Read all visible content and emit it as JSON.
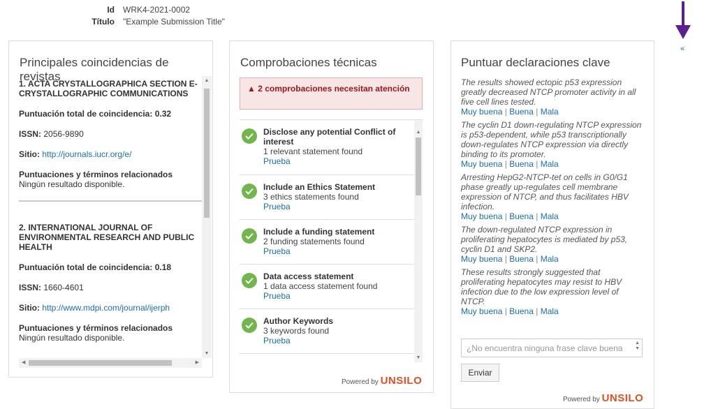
{
  "meta": {
    "id_label": "Id",
    "id_value": "WRK4-2021-0002",
    "title_label": "Título",
    "title_value": "\"Example Submission Title\""
  },
  "collapse_label": "«",
  "journals": {
    "heading": "Principales coincidencias de revistas",
    "items": [
      {
        "name": "1. ACTA CRYSTALLOGRAPHICA SECTION E-CRYSTALLOGRAPHIC COMMUNICATIONS",
        "score_label": "Puntuación total de coincidencia: 0.32",
        "issn_label": "ISSN:",
        "issn_value": "2056-9890",
        "site_label": "Sitio:",
        "site_url": "http://journals.iucr.org/e/",
        "terms_label": "Puntuaciones y términos relacionados",
        "terms_value": "Ningún resultado disponible."
      },
      {
        "name": "2. INTERNATIONAL JOURNAL OF ENVIRONMENTAL RESEARCH AND PUBLIC HEALTH",
        "score_label": "Puntuación total de coincidencia: 0.18",
        "issn_label": "ISSN:",
        "issn_value": "1660-4601",
        "site_label": "Sitio:",
        "site_url": "http://www.mdpi.com/journal/ijerph",
        "terms_label": "Puntuaciones y términos relacionados",
        "terms_value": "Ningún resultado disponible."
      }
    ]
  },
  "checks": {
    "heading": "Comprobaciones técnicas",
    "alert": "2 comprobaciones necesitan atención",
    "items": [
      {
        "title": "Disclose any potential Conflict of interest",
        "desc": "1 relevant statement found",
        "link": "Prueba"
      },
      {
        "title": "Include an Ethics Statement",
        "desc": "3 ethics statements found",
        "link": "Prueba"
      },
      {
        "title": "Include a funding statement",
        "desc": "2 funding statements found",
        "link": "Prueba"
      },
      {
        "title": "Data access statement",
        "desc": "1 data access statement found",
        "link": "Prueba"
      },
      {
        "title": "Author Keywords",
        "desc": "3 keywords found",
        "link": "Prueba"
      }
    ],
    "powered_prefix": "Powered by",
    "powered_brand": "UNSILO"
  },
  "statements": {
    "heading": "Puntuar declaraciones clave",
    "items": [
      {
        "text": "The results showed ectopic p53 expression greatly decreased NTCP promoter activity in all five cell lines tested."
      },
      {
        "text": "The cyclin D1 down-regulating NTCP expression is p53-dependent, while p53 transcriptionally down-regulates NTCP expression via directly binding to its promoter."
      },
      {
        "text": "Arresting HepG2-NTCP-tet on cells in G0/G1 phase greatly up-regulates cell membrane expression of NTCP, and thus facilitates HBV infection."
      },
      {
        "text": "The down-regulated NTCP expression in proliferating hepatocytes is mediated by p53, cyclin D1 and SKP2."
      },
      {
        "text": "These results strongly suggested that proliferating hepatocytes may resist to HBV infection due to the low expression level of NTCP."
      }
    ],
    "rating": {
      "very_good": "Muy buena",
      "good": "Buena",
      "bad": "Mala",
      "separator": "|"
    },
    "phrase_placeholder": "¿No encuentra ninguna frase clave buena",
    "submit_label": "Enviar",
    "powered_prefix": "Powered by",
    "powered_brand": "UNSILO"
  },
  "colors": {
    "link": "#1a6fb5",
    "alert_text": "#a0171a",
    "check_green": "#72b54a",
    "brand_orange": "#e44e1f",
    "arrow_purple": "#5b1f8f"
  },
  "icons": {
    "alert": "warning-icon",
    "check": "check-circle-icon",
    "arrow": "down-arrow-icon"
  }
}
